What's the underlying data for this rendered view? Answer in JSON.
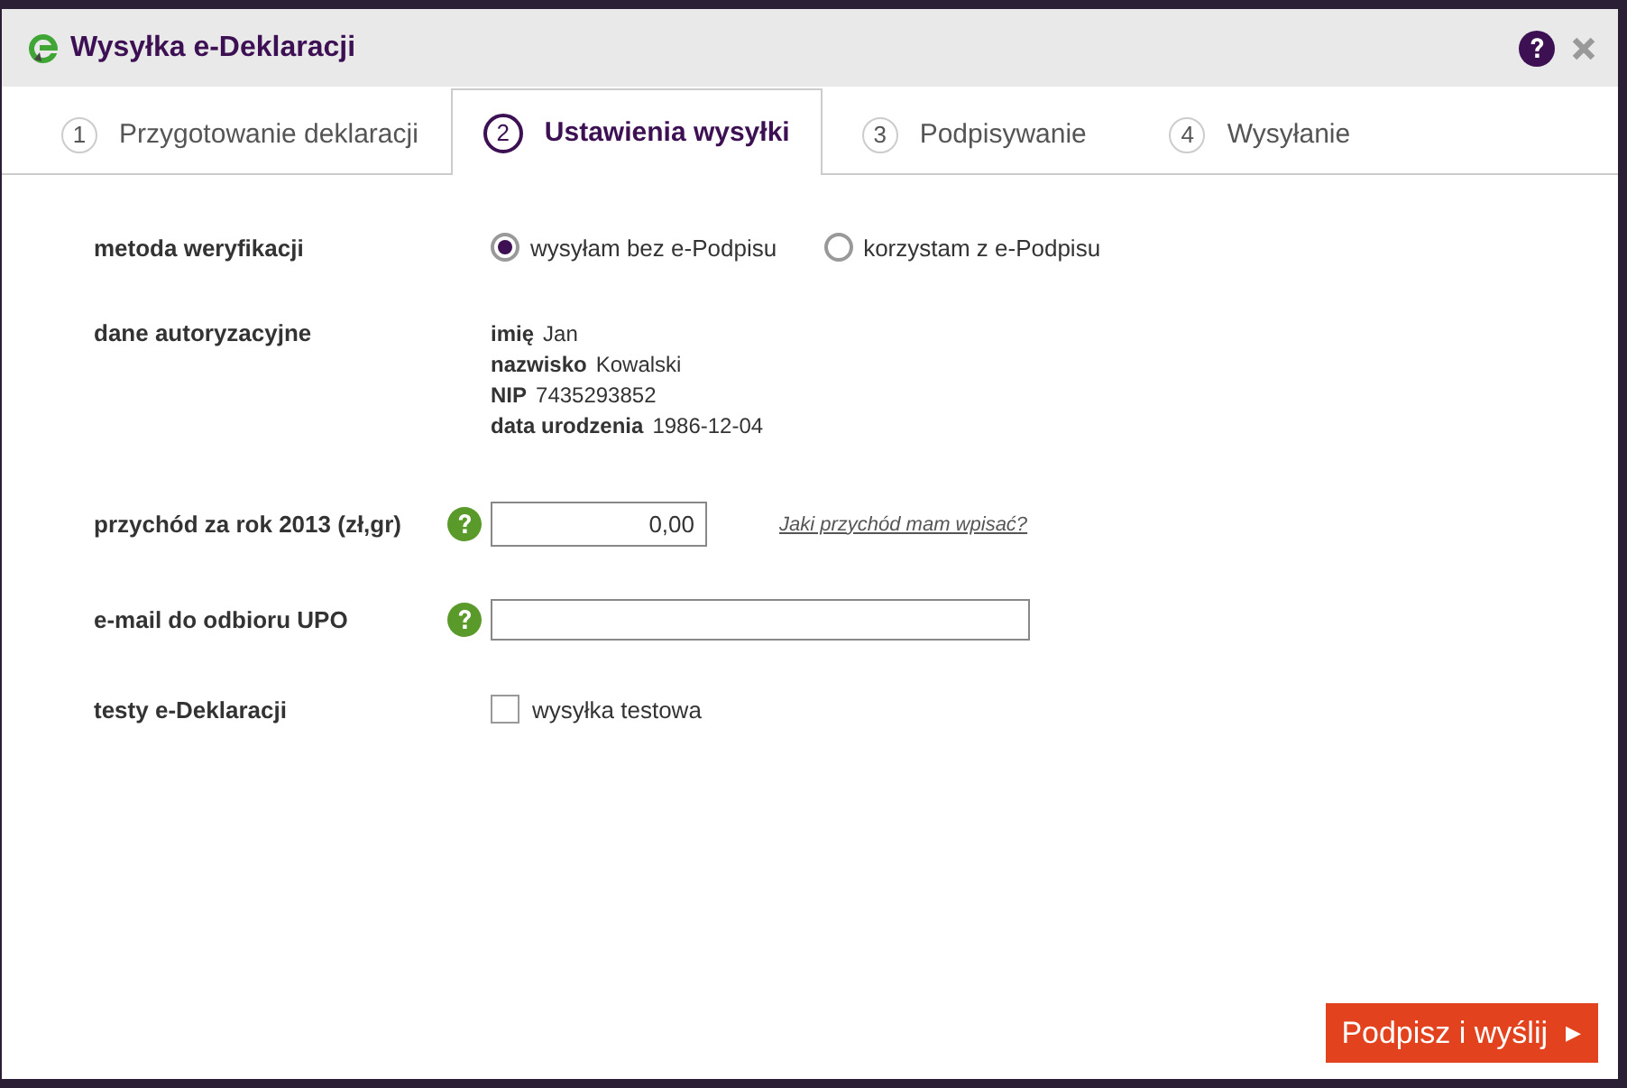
{
  "window": {
    "title": "Wysyłka e-Deklaracji"
  },
  "steps": [
    {
      "number": "1",
      "label": "Przygotowanie deklaracji",
      "selected": false
    },
    {
      "number": "2",
      "label": "Ustawienia wysyłki",
      "selected": true
    },
    {
      "number": "3",
      "label": "Podpisywanie",
      "selected": false
    },
    {
      "number": "4",
      "label": "Wysyłanie",
      "selected": false
    }
  ],
  "form": {
    "verification": {
      "label": "metoda weryfikacji",
      "options": [
        {
          "label": "wysyłam bez e-Podpisu",
          "selected": true
        },
        {
          "label": "korzystam z e-Podpisu",
          "selected": false
        }
      ]
    },
    "auth": {
      "label": "dane autoryzacyjne",
      "fields": [
        {
          "name": "imię",
          "value": "Jan"
        },
        {
          "name": "nazwisko",
          "value": "Kowalski"
        },
        {
          "name": "NIP",
          "value": "7435293852"
        },
        {
          "name": "data urodzenia",
          "value": "1986-12-04"
        }
      ]
    },
    "income": {
      "label": "przychód za rok 2013 (zł,gr)",
      "value": "0,00",
      "help_link": "Jaki przychód mam wpisać?"
    },
    "email": {
      "label": "e-mail do odbioru UPO"
    },
    "test": {
      "label": "testy e-Deklaracji",
      "option": "wysyłka testowa",
      "checked": false
    }
  },
  "submit": {
    "label": "Podpisz i wyślij",
    "icon": "▶"
  }
}
